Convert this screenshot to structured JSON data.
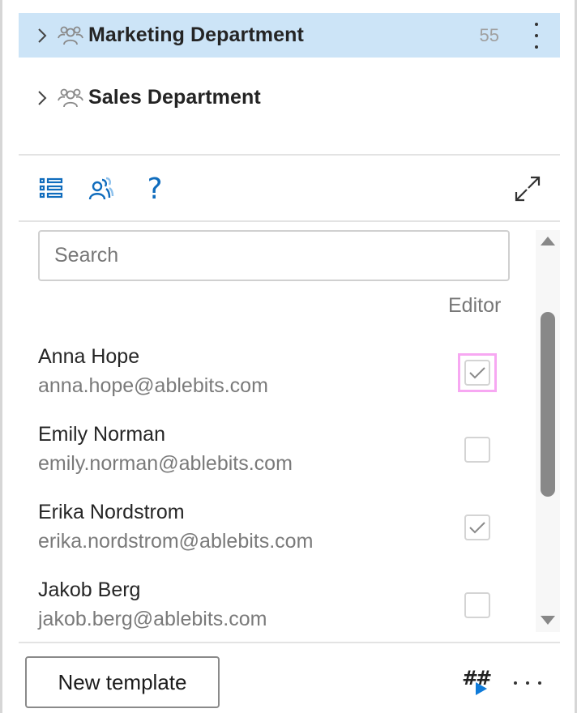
{
  "groups": [
    {
      "name": "Marketing Department",
      "count": "55",
      "selected": true,
      "icon": "people-group-icon",
      "expand_icon": "chevron-right-icon",
      "more_icon": "more-vertical-icon"
    },
    {
      "name": "Sales Department",
      "count": "",
      "selected": false,
      "icon": "people-group-icon",
      "expand_icon": "chevron-right-icon"
    }
  ],
  "toolbar": {
    "list_view_icon": "list-icon",
    "members_icon": "people-icon",
    "help_icon": "help-icon",
    "help_glyph": "?",
    "expand_icon": "expand-icon"
  },
  "search": {
    "placeholder": "Search",
    "value": ""
  },
  "columns": {
    "editor": "Editor"
  },
  "members": [
    {
      "name": "Anna Hope",
      "email": "anna.hope@ablebits.com",
      "editor": true,
      "focused": true
    },
    {
      "name": "Emily Norman",
      "email": "emily.norman@ablebits.com",
      "editor": false,
      "focused": false
    },
    {
      "name": "Erika Nordstrom",
      "email": "erika.nordstrom@ablebits.com",
      "editor": true,
      "focused": false
    },
    {
      "name": "Jakob Berg",
      "email": "jakob.berg@ablebits.com",
      "editor": false,
      "focused": false
    }
  ],
  "footer": {
    "new_template_label": "New template",
    "macro_glyph": "##",
    "macro_icon": "insert-macro-icon",
    "more_icon": "more-horizontal-icon"
  },
  "colors": {
    "selection": "#cce4f7",
    "accent": "#0f7bd9",
    "focus_ring": "#f7a8f2"
  }
}
